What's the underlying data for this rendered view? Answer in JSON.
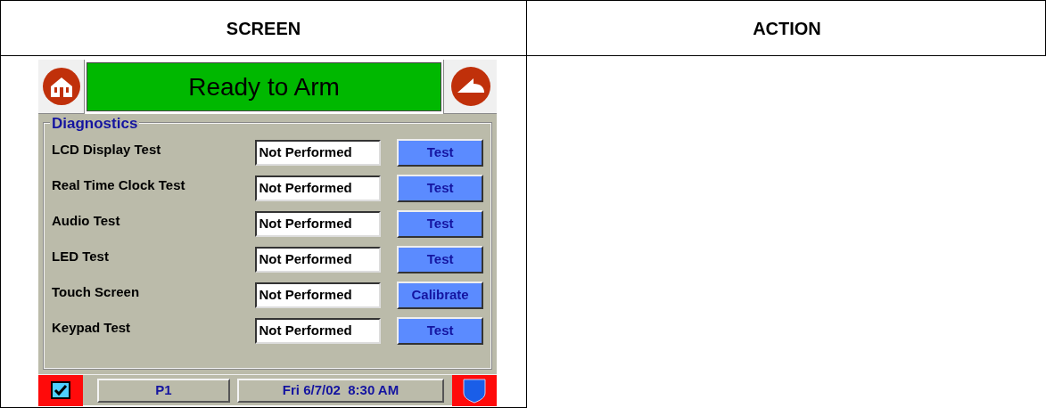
{
  "table": {
    "columns": [
      "SCREEN",
      "ACTION"
    ]
  },
  "screen": {
    "status_title": "Ready to Arm",
    "group_title": "Diagnostics",
    "tests": [
      {
        "name": "LCD Display Test",
        "result": "Not Performed",
        "button": "Test"
      },
      {
        "name": "Real Time Clock Test",
        "result": "Not Performed",
        "button": "Test"
      },
      {
        "name": "Audio Test",
        "result": "Not Performed",
        "button": "Test"
      },
      {
        "name": "LED Test",
        "result": "Not Performed",
        "button": "Test"
      },
      {
        "name": "Touch Screen",
        "result": "Not Performed",
        "button": "Calibrate"
      },
      {
        "name": "Keypad Test",
        "result": "Not Performed",
        "button": "Test"
      }
    ],
    "status_bar": {
      "partition": "P1",
      "datetime": "Fri 6/7/02  8:30 AM"
    }
  }
}
